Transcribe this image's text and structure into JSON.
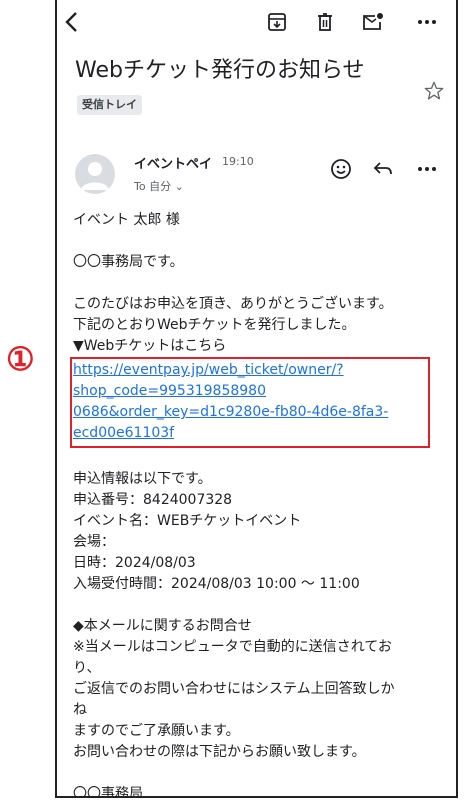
{
  "toolbar": {
    "icons": [
      "back-arrow-icon",
      "archive-icon",
      "delete-icon",
      "mark-unread-icon",
      "more-icon"
    ]
  },
  "email": {
    "subject": "Webチケット発行のお知らせ",
    "label": "受信トレイ",
    "sender": "イベントペイ",
    "time": "19:10",
    "to": "To 自分 ⌄"
  },
  "body": {
    "greeting": "イベント 太郎 様",
    "intro": "〇〇事務局です。",
    "thanks": "このたびはお申込を頂き、ありがとうございます。",
    "issued": "下記のとおりWebチケットを発行しました。",
    "ticket_heading": "▼Webチケットはこちら",
    "ticket_link_lines": [
      "https://eventpay.jp/web_ticket/owner/?",
      "shop_code=995319858980",
      "0686&order_key=d1c9280e-fb80-4d6e-8fa3-",
      "ecd00e61103f"
    ],
    "info_heading": "申込情報は以下です。",
    "order_number": "申込番号：8424007328",
    "event_name": "イベント名：WEBチケットイベント",
    "venue": "会場：",
    "datetime": "日時：2024/08/03",
    "entry_time": "入場受付時間：2024/08/03 10:00 ～ 11:00",
    "contact_heading": "◆本メールに関するお問合せ",
    "note_line1": "※当メールはコンピュータで自動的に送信されてお",
    "note_line2": "り、",
    "note_line3": "ご返信でのお問い合わせにはシステム上回答致しか",
    "note_line4": "ね",
    "note_line5": "ますのでご了承願います。",
    "note_line6": "お問い合わせの際は下記からお願い致します。",
    "signature": "〇〇事務局"
  },
  "annotation": {
    "marker": "①",
    "color": "#e0202a"
  },
  "colors": {
    "link": "#1a73e8",
    "text": "#202124",
    "muted": "#5f6368"
  }
}
